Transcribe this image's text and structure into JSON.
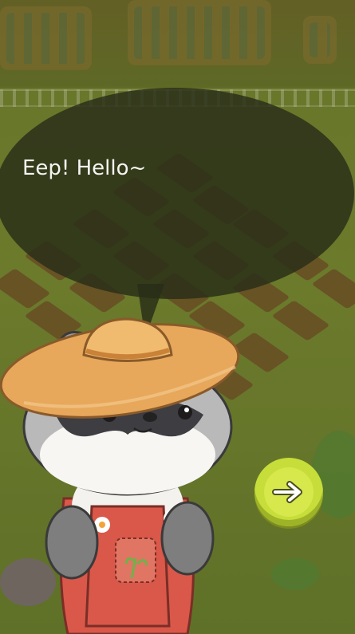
{
  "dialogue": {
    "speech_text": "Eep! Hello~"
  },
  "character": {
    "name": "raccoon-farmer",
    "hat_color": "#e7a85c",
    "overalls_color": "#d9584a"
  },
  "next_button": {
    "icon": "arrow-right-icon",
    "color": "#c7dd3a"
  },
  "colors": {
    "background": "#7a8a31",
    "bubble": "#2b2f1a",
    "text": "#f4f4f0"
  }
}
